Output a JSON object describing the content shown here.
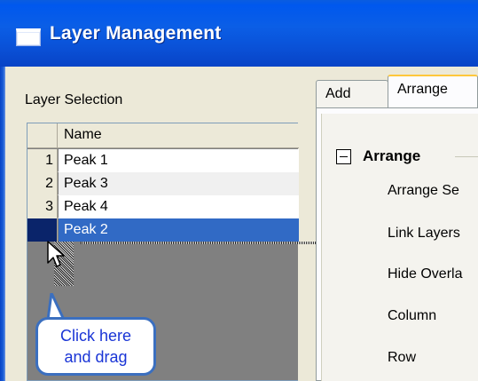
{
  "window": {
    "title": "Layer Management"
  },
  "layer_selection": {
    "label": "Layer Selection",
    "column_header": "Name",
    "rows": [
      {
        "num": "1",
        "name": "Peak 1"
      },
      {
        "num": "2",
        "name": "Peak 3"
      },
      {
        "num": "3",
        "name": "Peak 4"
      },
      {
        "num": "",
        "name": "Peak 2"
      }
    ]
  },
  "tabs": [
    {
      "label": "Add"
    },
    {
      "label": "Arrange"
    }
  ],
  "arrange": {
    "section_title": "Arrange",
    "properties": [
      {
        "label": "Arrange Se"
      },
      {
        "label": "Link Layers"
      },
      {
        "label": "Hide Overla"
      },
      {
        "label": "Column"
      },
      {
        "label": "Row"
      }
    ]
  },
  "callout": {
    "line1": "Click here",
    "line2": "and drag"
  }
}
